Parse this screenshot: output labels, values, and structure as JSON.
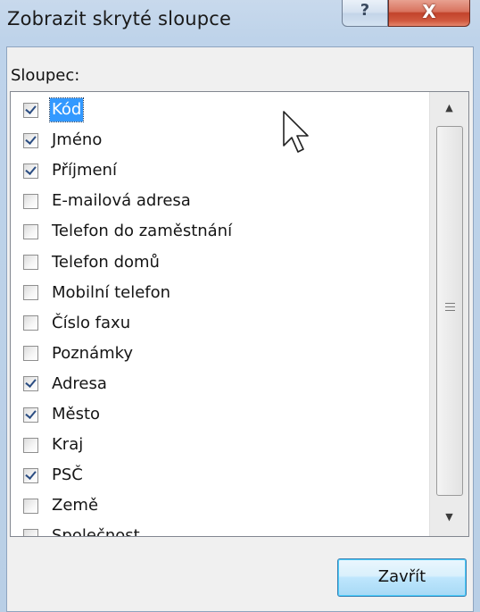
{
  "window": {
    "title": "Zobrazit skryté sloupce",
    "help_glyph": "?",
    "close_glyph": "X"
  },
  "dialog": {
    "column_label": "Sloupec:",
    "items": [
      {
        "label": "Kód",
        "checked": true,
        "selected": true
      },
      {
        "label": "Jméno",
        "checked": true,
        "selected": false
      },
      {
        "label": "Příjmení",
        "checked": true,
        "selected": false
      },
      {
        "label": "E-mailová adresa",
        "checked": false,
        "selected": false
      },
      {
        "label": "Telefon do zaměstnání",
        "checked": false,
        "selected": false
      },
      {
        "label": "Telefon domů",
        "checked": false,
        "selected": false
      },
      {
        "label": "Mobilní telefon",
        "checked": false,
        "selected": false
      },
      {
        "label": "Číslo faxu",
        "checked": false,
        "selected": false
      },
      {
        "label": "Poznámky",
        "checked": false,
        "selected": false
      },
      {
        "label": "Adresa",
        "checked": true,
        "selected": false
      },
      {
        "label": "Město",
        "checked": true,
        "selected": false
      },
      {
        "label": "Kraj",
        "checked": false,
        "selected": false
      },
      {
        "label": "PSČ",
        "checked": true,
        "selected": false
      },
      {
        "label": "Země",
        "checked": false,
        "selected": false
      },
      {
        "label": "Společnost",
        "checked": false,
        "selected": false
      }
    ],
    "close_button_label": "Zavřít"
  },
  "icons": {
    "scroll_up": "scroll-up-arrow-icon",
    "scroll_down": "scroll-down-arrow-icon",
    "grip": "scrollbar-grip-icon",
    "cursor": "mouse-pointer-icon"
  },
  "colors": {
    "selection": "#3399ff",
    "check": "#2b4d82",
    "close_red": "#c2432b",
    "title_bg": "#bed3ea"
  }
}
